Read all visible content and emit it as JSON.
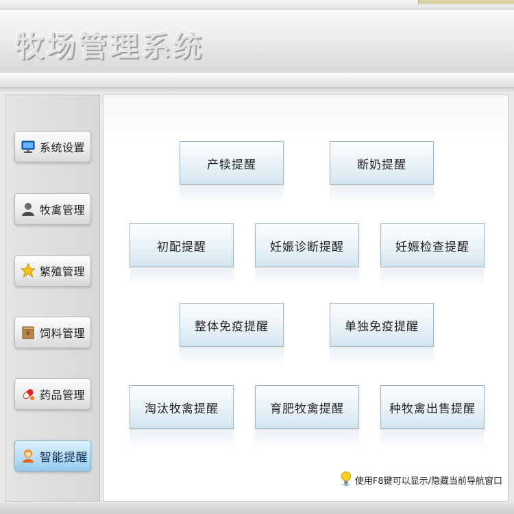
{
  "app": {
    "title": "牧场管理系统"
  },
  "sidebar": {
    "items": [
      {
        "label": "系统设置",
        "icon": "monitor-icon",
        "active": false
      },
      {
        "label": "牧禽管理",
        "icon": "user-icon",
        "active": false
      },
      {
        "label": "繁殖管理",
        "icon": "star-icon",
        "active": false
      },
      {
        "label": "饲料管理",
        "icon": "box-icon",
        "active": false
      },
      {
        "label": "药品管理",
        "icon": "pill-icon",
        "active": false
      },
      {
        "label": "智能提醒",
        "icon": "assistant-icon",
        "active": true
      }
    ]
  },
  "reminders": {
    "row1": [
      "产犊提醒",
      "断奶提醒"
    ],
    "row2": [
      "初配提醒",
      "妊娠诊断提醒",
      "妊娠检查提醒"
    ],
    "row3": [
      "整体免疫提醒",
      "单独免疫提醒"
    ],
    "row4": [
      "淘汰牧禽提醒",
      "育肥牧禽提醒",
      "种牧禽出售提醒"
    ]
  },
  "hint": {
    "text": "使用F8键可以显示/隐藏当前导航窗口",
    "icon": "lightbulb-icon"
  },
  "colors": {
    "accent": "#95c9ec",
    "button_border": "#9cb6c6"
  }
}
